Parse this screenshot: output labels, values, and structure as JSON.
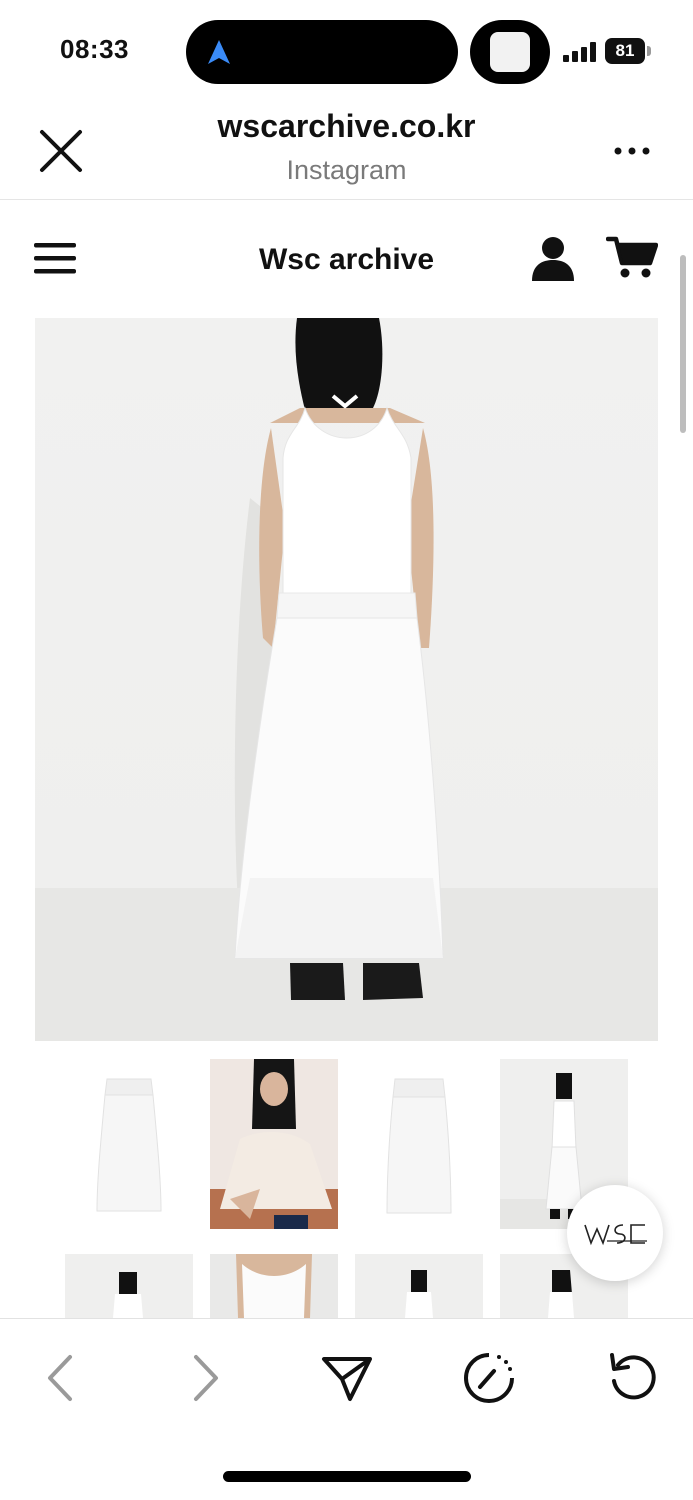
{
  "status_bar": {
    "time": "08:33",
    "battery_level": "81",
    "icons": [
      "location-arrow-icon",
      "signal-icon",
      "battery-icon"
    ]
  },
  "browser": {
    "domain": "wscarchive.co.kr",
    "source_app": "Instagram",
    "close_icon": "close-icon",
    "more_icon": "more-icon"
  },
  "site": {
    "brand": "Wsc archive",
    "menu_icon": "hamburger-menu-icon",
    "account_icon": "account-icon",
    "cart_icon": "cart-icon"
  },
  "floating_logo": "WSC",
  "toolbar": {
    "items": [
      "back-icon",
      "forward-icon",
      "share-icon",
      "loading-icon",
      "refresh-icon"
    ]
  },
  "colors": {
    "accent_blue": "#1a73e8",
    "text": "#111111",
    "muted": "#7a7a7a"
  }
}
